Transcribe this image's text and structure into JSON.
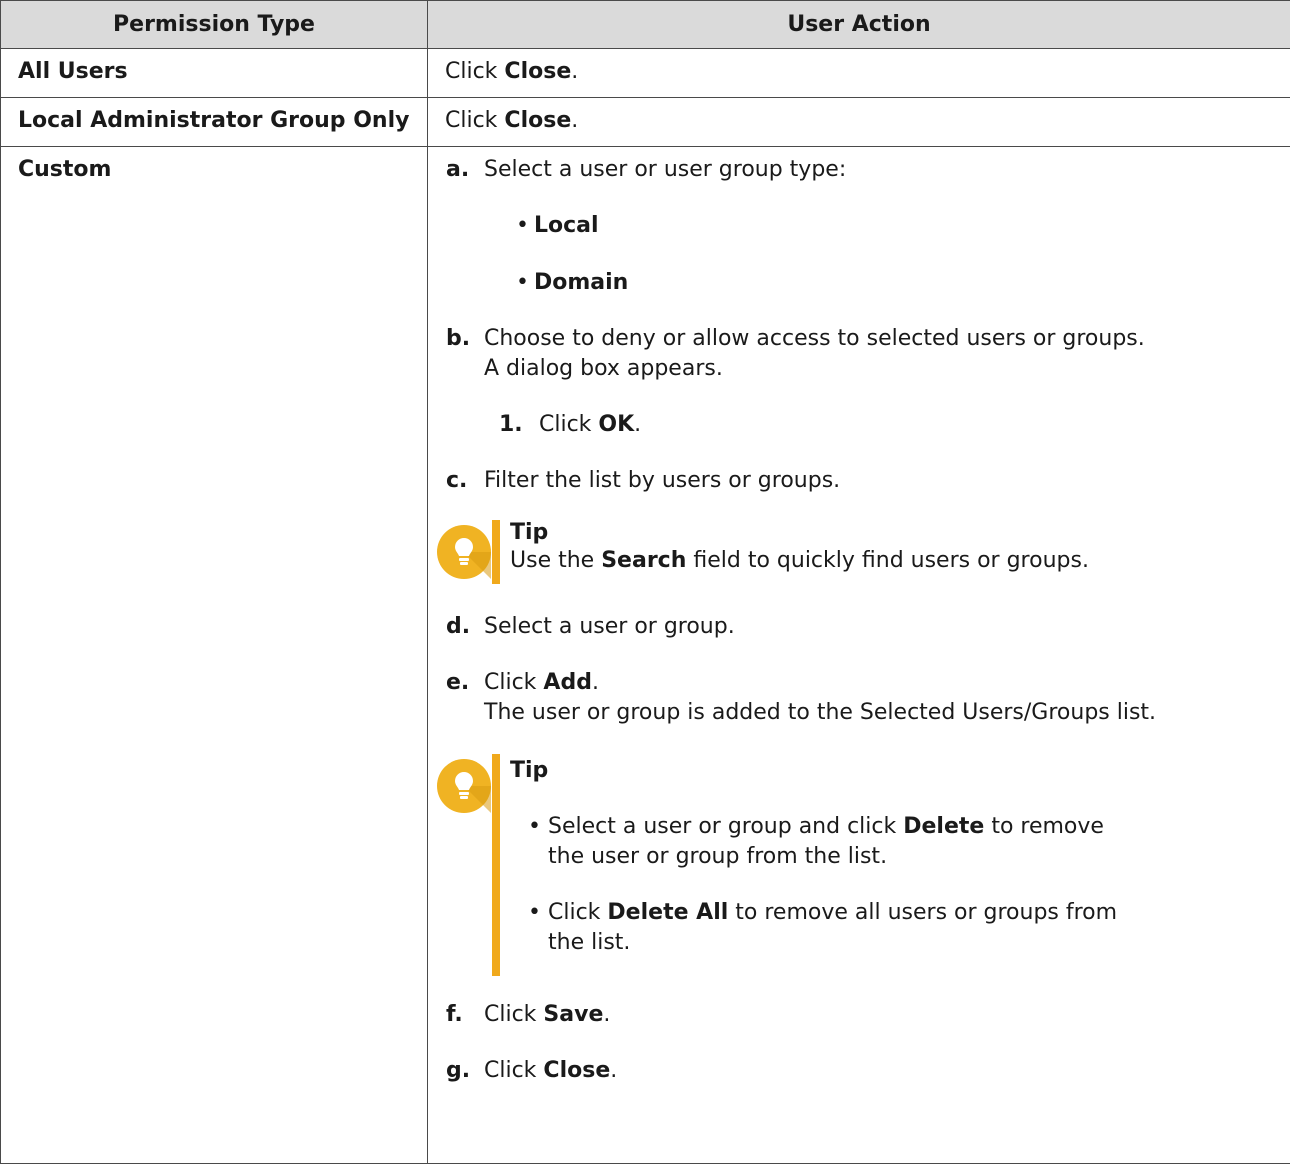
{
  "table": {
    "headers": [
      "Permission Type",
      "User Action"
    ],
    "row_all_users": {
      "type": "All Users",
      "action_prefix": "Click ",
      "action_bold": "Close",
      "action_suffix": "."
    },
    "row_local_admin": {
      "type": "Local Administrator Group Only",
      "action_prefix": "Click ",
      "action_bold": "Close",
      "action_suffix": "."
    },
    "row_custom": {
      "type": "Custom",
      "step_a": {
        "marker": "a.",
        "text": "Select a user or user group type:",
        "options": [
          "Local",
          "Domain"
        ]
      },
      "step_b": {
        "marker": "b.",
        "text": "Choose to deny or allow access to selected users or groups.",
        "result": "A dialog box appears.",
        "substep": {
          "marker": "1.",
          "prefix": "Click ",
          "bold": "OK",
          "suffix": "."
        }
      },
      "step_c": {
        "marker": "c.",
        "text": "Filter the list by users or groups."
      },
      "tip1": {
        "title": "Tip",
        "prefix": "Use the ",
        "bold": "Search",
        "suffix": " field to quickly find users or groups."
      },
      "step_d": {
        "marker": "d.",
        "text": "Select a user or group."
      },
      "step_e": {
        "marker": "e.",
        "prefix": "Click ",
        "bold": "Add",
        "suffix": ".",
        "result": "The user or group is added to the Selected Users/Groups list."
      },
      "tip2": {
        "title": "Tip",
        "item1": {
          "prefix": "Select a user or group and click ",
          "bold": "Delete",
          "line1_suffix": " to remove",
          "line2": "the user or group from the list."
        },
        "item2": {
          "prefix": "Click ",
          "bold": "Delete All",
          "line1_suffix": " to remove all users or groups from",
          "line2": "the list."
        }
      },
      "step_f": {
        "marker": "f.",
        "prefix": "Click ",
        "bold": "Save",
        "suffix": "."
      },
      "step_g": {
        "marker": "g.",
        "prefix": "Click ",
        "bold": "Close",
        "suffix": "."
      }
    }
  },
  "icons": {
    "tip_icon": "lightbulb-icon",
    "tip_icon_color": "#f0b323",
    "tip_bar_color": "#f0a91c"
  },
  "colors": {
    "header_bg": "#dadada",
    "border": "#4a4a4a"
  }
}
